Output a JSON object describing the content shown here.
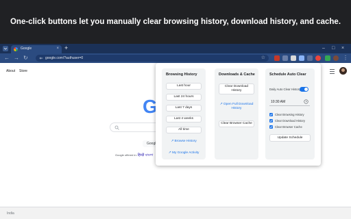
{
  "banner": "One-click buttons let you manually clear browsing history, download history, and cache.",
  "browser": {
    "tab_title": "Google",
    "tab_close": "×",
    "new_tab": "+",
    "window_controls": [
      "–",
      "□",
      "×"
    ],
    "nav": {
      "back": "←",
      "forward": "→",
      "reload": "↻"
    },
    "url": "google.com/?authuser=0",
    "star": "☆",
    "menu": "⋮"
  },
  "google": {
    "links": [
      "About",
      "Store"
    ],
    "logo": "G",
    "button": "Google Search",
    "offered_in_prefix": "Google offered in:",
    "offered_in_langs": "हिन्दी  বাংলা"
  },
  "footer": {
    "region": "India"
  },
  "popup": {
    "browsing": {
      "title": "Browsing History",
      "buttons": [
        "Last hour",
        "Last 24 hours",
        "Last 7 days",
        "Last 4 weeks",
        "All time"
      ],
      "links": [
        "↗ Browse History",
        "↗ My Google Activity"
      ]
    },
    "downloads": {
      "title": "Downloads & Cache",
      "clear_downloads": "Clear Download History",
      "open_downloads": "↗ Open Full Download History",
      "clear_cache": "Clear Browser Cache"
    },
    "schedule": {
      "title": "Schedule Auto Clear",
      "toggle_label": "Daily Auto Clear History",
      "toggle_on": true,
      "time": "10:30 AM",
      "checkboxes": [
        "Clear Browsing History",
        "Clear Download History",
        "Clear Browser Cache"
      ],
      "update_button": "Update Schedule"
    }
  }
}
